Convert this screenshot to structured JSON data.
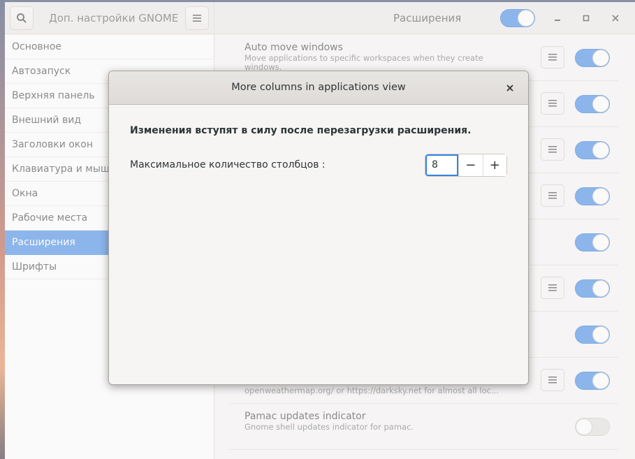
{
  "header": {
    "app_title": "Доп. настройки GNOME",
    "page_title": "Расширения",
    "search_icon": "search-icon",
    "menu_icon": "hamburger-menu-icon",
    "extensions_enabled": true
  },
  "sidebar": {
    "items": [
      {
        "label": "Основное"
      },
      {
        "label": "Автозапуск"
      },
      {
        "label": "Верхняя панель"
      },
      {
        "label": "Внешний вид"
      },
      {
        "label": "Заголовки окон"
      },
      {
        "label": "Клавиатура и мышь"
      },
      {
        "label": "Окна"
      },
      {
        "label": "Рабочие места"
      },
      {
        "label": "Расширения",
        "active": true
      },
      {
        "label": "Шрифты"
      }
    ]
  },
  "extensions": [
    {
      "title": "Auto move windows",
      "desc": "Move applications to specific workspaces when they create\nwindows.",
      "has_settings": true,
      "enabled": true
    },
    {
      "title": "",
      "desc": "",
      "has_settings": true,
      "enabled": true
    },
    {
      "title": "",
      "desc": "",
      "has_settings": true,
      "enabled": true
    },
    {
      "title": "",
      "desc": "",
      "has_settings": true,
      "enabled": true
    },
    {
      "title": "",
      "desc": "",
      "has_settings": false,
      "enabled": true
    },
    {
      "title": "",
      "desc": "",
      "has_settings": true,
      "enabled": true
    },
    {
      "title": "",
      "desc": "",
      "has_settings": false,
      "enabled": true
    },
    {
      "title": "",
      "desc": "openweathermap.org/ or https://darksky.net for almost all loc...",
      "has_settings": true,
      "enabled": true
    },
    {
      "title": "Pamac updates indicator",
      "desc": "Gnome shell updates indicator for pamac.",
      "has_settings": false,
      "enabled": false
    }
  ],
  "dialog": {
    "title": "More columns in applications view",
    "note": "Изменения вступят в силу после перезагрузки расширения.",
    "label": "Максимальное количество столбцов :",
    "value": "8",
    "minus": "−",
    "plus": "+",
    "close_glyph": "×"
  },
  "colors": {
    "accent": "#3584e4"
  }
}
